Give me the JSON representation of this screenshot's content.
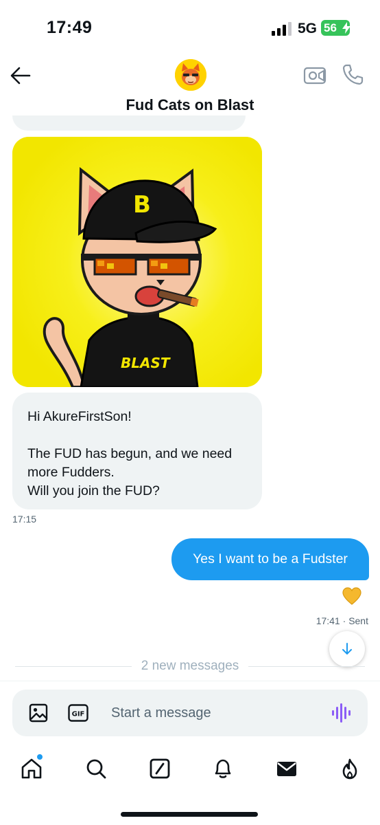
{
  "status_bar": {
    "time": "17:49",
    "network": "5G",
    "battery": "56",
    "battery_color": "#36c35a"
  },
  "header": {
    "title": "Fud Cats on Blast",
    "back_icon": "arrow-left-icon",
    "video_icon": "video-camera-icon",
    "phone_icon": "phone-icon"
  },
  "messages": {
    "received_text": "Hi AkureFirstSon!\n\nThe FUD has begun, and we need more Fudders.\nWill you join the FUD?",
    "received_time": "17:15",
    "sent_text": "Yes I want to be a Fudster",
    "sent_time": "17:41",
    "sent_status": "Sent",
    "sent_separator": " · ",
    "reaction_icon": "yellow-heart-icon",
    "image_shirt_text": "BLAST"
  },
  "new_messages_label": "2 new messages",
  "composer": {
    "placeholder": "Start a message",
    "gif_label": "GIF"
  },
  "nav": {
    "items": [
      "home-icon",
      "search-icon",
      "grok-icon",
      "notifications-icon",
      "messages-icon",
      "fire-icon"
    ]
  },
  "colors": {
    "accent": "#1d9bf0",
    "bubble_gray": "#eff3f4",
    "voice_purple": "#8b5cf6",
    "image_bg": "#f6ee16"
  }
}
